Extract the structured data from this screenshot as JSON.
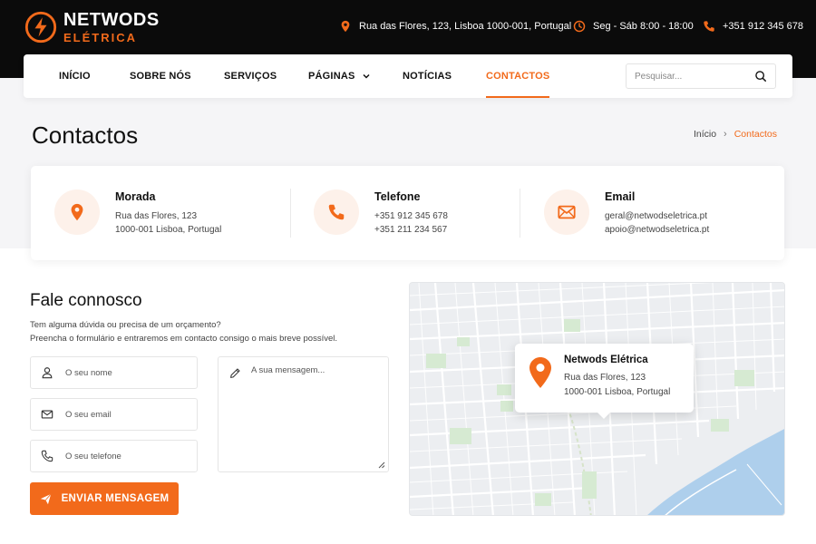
{
  "brand": {
    "name": "NETWODS",
    "sub": "ELÉTRICA",
    "accent": "#f26a1b",
    "dark": "#0b0b0b"
  },
  "topbar": {
    "address": "Rua das Flores, 123, Lisboa 1000-001, Portugal",
    "hours": "Seg - Sáb 8:00 - 18:00",
    "phone": "+351 912 345 678"
  },
  "nav": {
    "items": [
      {
        "label": "INÍCIO"
      },
      {
        "label": "SOBRE NÓS"
      },
      {
        "label": "SERVIÇOS"
      },
      {
        "label": "PÁGINAS",
        "has_dropdown": true
      },
      {
        "label": "NOTÍCIAS"
      },
      {
        "label": "CONTACTOS",
        "active": true
      }
    ],
    "search_placeholder": "Pesquisar..."
  },
  "page": {
    "title": "Contactos",
    "breadcrumb": {
      "home": "Início",
      "current": "Contactos"
    }
  },
  "contact_info": [
    {
      "icon": "location-pin-icon",
      "title": "Morada",
      "lines": [
        "Rua das Flores, 123",
        "1000-001 Lisboa, Portugal"
      ]
    },
    {
      "icon": "phone-icon",
      "title": "Telefone",
      "lines": [
        "+351 912 345 678",
        "+351 211 234 567"
      ]
    },
    {
      "icon": "envelope-icon",
      "title": "Email",
      "lines": [
        "geral@netwodseletrica.pt",
        "apoio@netwodseletrica.pt"
      ]
    }
  ],
  "form": {
    "title": "Fale connosco",
    "desc_1": "Tem alguma dúvida ou precisa de um orçamento?",
    "desc_2": "Preencha o formulário e entraremos em contacto consigo o mais breve possível.",
    "name_placeholder": "O seu nome",
    "email_placeholder": "O seu email",
    "phone_placeholder": "O seu telefone",
    "message_placeholder": "A sua mensagem...",
    "submit_label": "ENVIAR MENSAGEM"
  },
  "map": {
    "name": "Netwods Elétrica",
    "line_1": "Rua das Flores, 123",
    "line_2": "1000-001 Lisboa, Portugal"
  }
}
